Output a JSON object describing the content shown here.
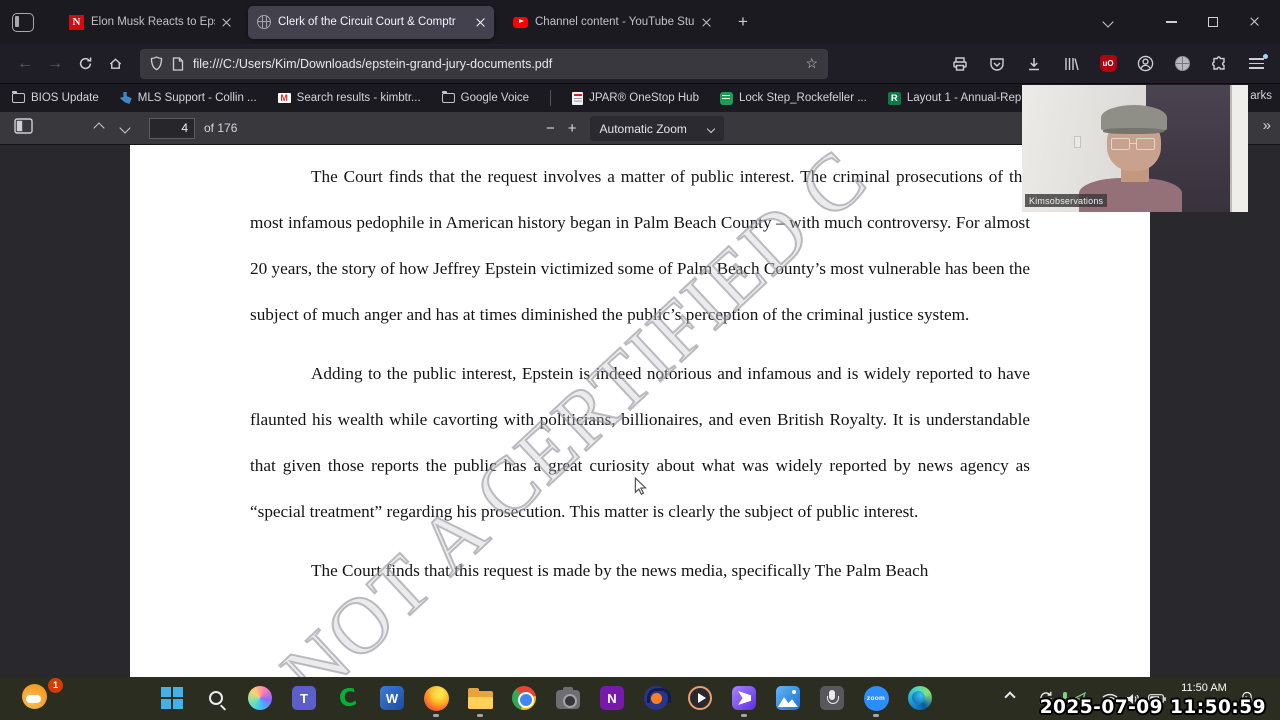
{
  "browser": {
    "tabs": [
      {
        "title": "Elon Musk Reacts to Epstein Lis",
        "favicon_letter": "N"
      },
      {
        "title": "Clerk of the Circuit Court & Comptr"
      },
      {
        "title": "Channel content - YouTube Stu"
      }
    ],
    "new_tab_glyph": "+",
    "nav": {
      "back_glyph": "←",
      "forward_glyph": "→",
      "url": "file:///C:/Users/Kim/Downloads/epstein-grand-jury-documents.pdf",
      "star_glyph": "☆",
      "ublock_label": "uO"
    },
    "bookmarks": [
      {
        "label": "BIOS Update",
        "icon": "folder"
      },
      {
        "label": "MLS Support - Collin ...",
        "icon": "texas-shape"
      },
      {
        "label": "Search results - kimbtr...",
        "icon": "gmail",
        "icon_letter": "M"
      },
      {
        "label": "Google Voice",
        "icon": "folder"
      },
      {
        "label": "JPAR® OneStop Hub",
        "icon": "document"
      },
      {
        "label": "Lock Step_Rockefeller ...",
        "icon": "green-card"
      },
      {
        "label": "Layout 1 - Annual-Rep...",
        "icon": "green-square-r",
        "icon_letter": "R"
      }
    ],
    "bookmarks_overflow": "arks"
  },
  "pdf": {
    "toolbar": {
      "page_value": "4",
      "of_label": "of 176",
      "zoom_label": "Automatic Zoom",
      "minus_glyph": "−",
      "plus_glyph": "+",
      "overflow_glyph": "»"
    },
    "document": {
      "watermark": "NOT A CERTIFIED C",
      "paragraphs": [
        "The Court finds that the request involves a matter of public interest.  The criminal prosecutions of the most infamous pedophile in American history began in Palm Beach County – with much controversy.  For almost 20 years, the story of how Jeffrey Epstein victimized some of Palm Beach County’s most vulnerable has been the subject of much anger and has at times diminished the public’s perception of the criminal justice system.",
        "Adding to the public interest, Epstein is indeed notorious and infamous and is widely reported to have flaunted his wealth while cavorting with politicians, billionaires, and even British Royalty.  It is understandable that given those reports the public has a great curiosity about what was widely reported by news agency as “special treatment” regarding his prosecution.  This matter is clearly the subject of public interest.",
        "The Court finds that this request is made by the news media, specifically The Palm Beach"
      ]
    }
  },
  "webcam": {
    "label": "Kimsobservations"
  },
  "taskbar": {
    "widgets_badge": "1",
    "letters": {
      "teams": "T",
      "cricut": "C",
      "word": "W",
      "onenote": "N",
      "zoom": "zoom"
    },
    "tray": {
      "time": "11:50 AM"
    }
  },
  "recording_overlay": {
    "timestamp": "2025-07-09 11:50:59"
  }
}
